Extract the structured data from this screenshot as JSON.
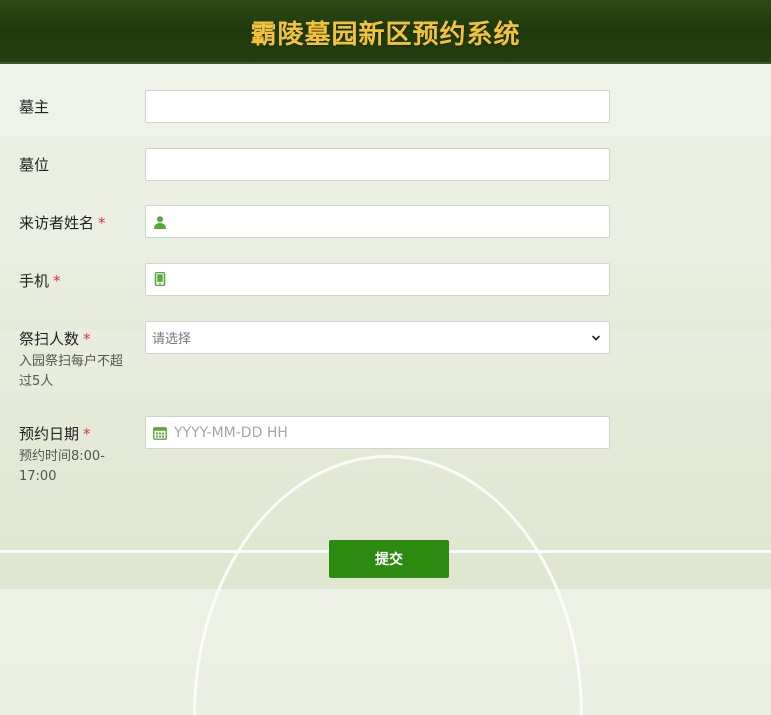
{
  "header": {
    "title": "霸陵墓园新区预约系统"
  },
  "form": {
    "tomb_owner": {
      "label": "墓主",
      "value": ""
    },
    "tomb_position": {
      "label": "墓位",
      "value": ""
    },
    "visitor_name": {
      "label": "来访者姓名",
      "required_mark": "*",
      "value": "",
      "icon": "user-icon"
    },
    "phone": {
      "label": "手机",
      "required_mark": "*",
      "value": "",
      "icon": "mobile-icon"
    },
    "visitor_count": {
      "label": "祭扫人数",
      "required_mark": "*",
      "hint": "入园祭扫每户不超过5人",
      "selected": "请选择"
    },
    "appointment_date": {
      "label": "预约日期",
      "required_mark": "*",
      "hint": "预约时间8:00-17:00",
      "placeholder": "YYYY-MM-DD HH",
      "icon": "calendar-icon"
    }
  },
  "submit": {
    "label": "提交"
  },
  "colors": {
    "header_bg": "#244011",
    "title": "#f2c33a",
    "required": "#d9363e",
    "button": "#2d8a11",
    "icon_green": "#5aa83a"
  }
}
